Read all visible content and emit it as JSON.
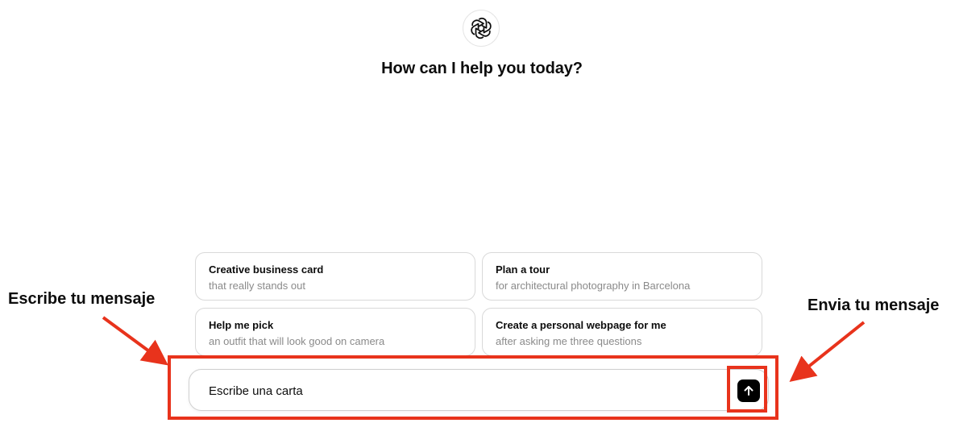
{
  "headline": "How can I help you today?",
  "suggestions": [
    {
      "title": "Creative business card",
      "subtitle": "that really stands out"
    },
    {
      "title": "Plan a tour",
      "subtitle": "for architectural photography in Barcelona"
    },
    {
      "title": "Help me pick",
      "subtitle": "an outfit that will look good on camera"
    },
    {
      "title": "Create a personal webpage for me",
      "subtitle": "after asking me three questions"
    }
  ],
  "composer": {
    "value": "Escribe una carta",
    "send_icon": "arrow-up-icon"
  },
  "annotations": {
    "left_label": "Escribe tu mensaje",
    "right_label": "Envia tu mensaje",
    "color": "#e8331c"
  },
  "colors": {
    "send_button": "#000000",
    "card_border": "#d9d9d9",
    "subtitle": "#8a8a8a"
  }
}
